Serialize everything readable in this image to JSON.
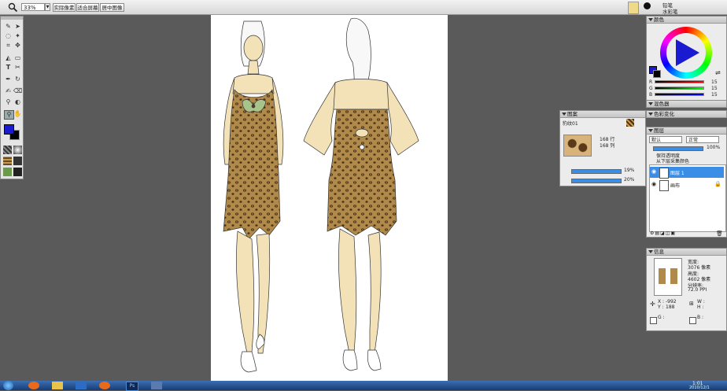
{
  "toolbar": {
    "zoom_value": "33%",
    "actual_pixels_label": "实际像素",
    "fit_screen_label": "适合屏幕",
    "center_image_label": "居中图像",
    "brush_name_1": "铅笔",
    "brush_name_2": "水彩笔"
  },
  "color_panel": {
    "title": "颜色",
    "r_label": "R",
    "g_label": "G",
    "b_label": "B",
    "r_value": "15",
    "g_value": "15",
    "b_value": "15",
    "mixer_title": "混色器",
    "variation_title": "色彩变化"
  },
  "pattern_panel": {
    "title": "图案",
    "pattern_name": "豹纹01",
    "rows_text": "168 行",
    "cols_text": "168 列",
    "slider1_value": "19%",
    "slider2_value": "20%"
  },
  "layers_panel": {
    "title": "图层",
    "blend_mode": "默认",
    "composite_mode": "正常",
    "opacity_value": "100%",
    "preserve_transparency_label": "保持透明度",
    "pick_up_color_label": "从下层采集颜色",
    "layers": [
      {
        "name": "图层 1",
        "selected": true
      },
      {
        "name": "画布",
        "selected": false
      }
    ]
  },
  "info_panel": {
    "title": "信息",
    "width_label": "宽度:",
    "width_value": "3076 像素",
    "height_label": "高度:",
    "height_value": "4602 像素",
    "resolution_label": "分辨率:",
    "resolution_value": "72.0 PPI",
    "x_label": "X :",
    "x_value": "-992",
    "y_label": "Y :",
    "y_value": "188",
    "w_label": "W :",
    "h_label": "H :",
    "g_label": "G :",
    "b_label": "B :"
  },
  "taskbar": {
    "clock": "1:01",
    "date": "2010/12/1"
  },
  "colors": {
    "workspace": "#5a5a5a",
    "primary_color": "#1a1ad0",
    "secondary_color": "#000000",
    "selection_blue": "#3a8ee6",
    "skin": "#f3e2b8",
    "leopard_base": "#b08a4a",
    "bow_green": "#a7c48a"
  },
  "icons": [
    "magnifier-icon",
    "brush-icon",
    "lasso-icon",
    "crop-icon",
    "bucket-icon",
    "text-icon",
    "eyedropper-icon",
    "hand-icon",
    "eye-icon",
    "lock-icon",
    "trash-icon",
    "color-wheel-icon"
  ]
}
